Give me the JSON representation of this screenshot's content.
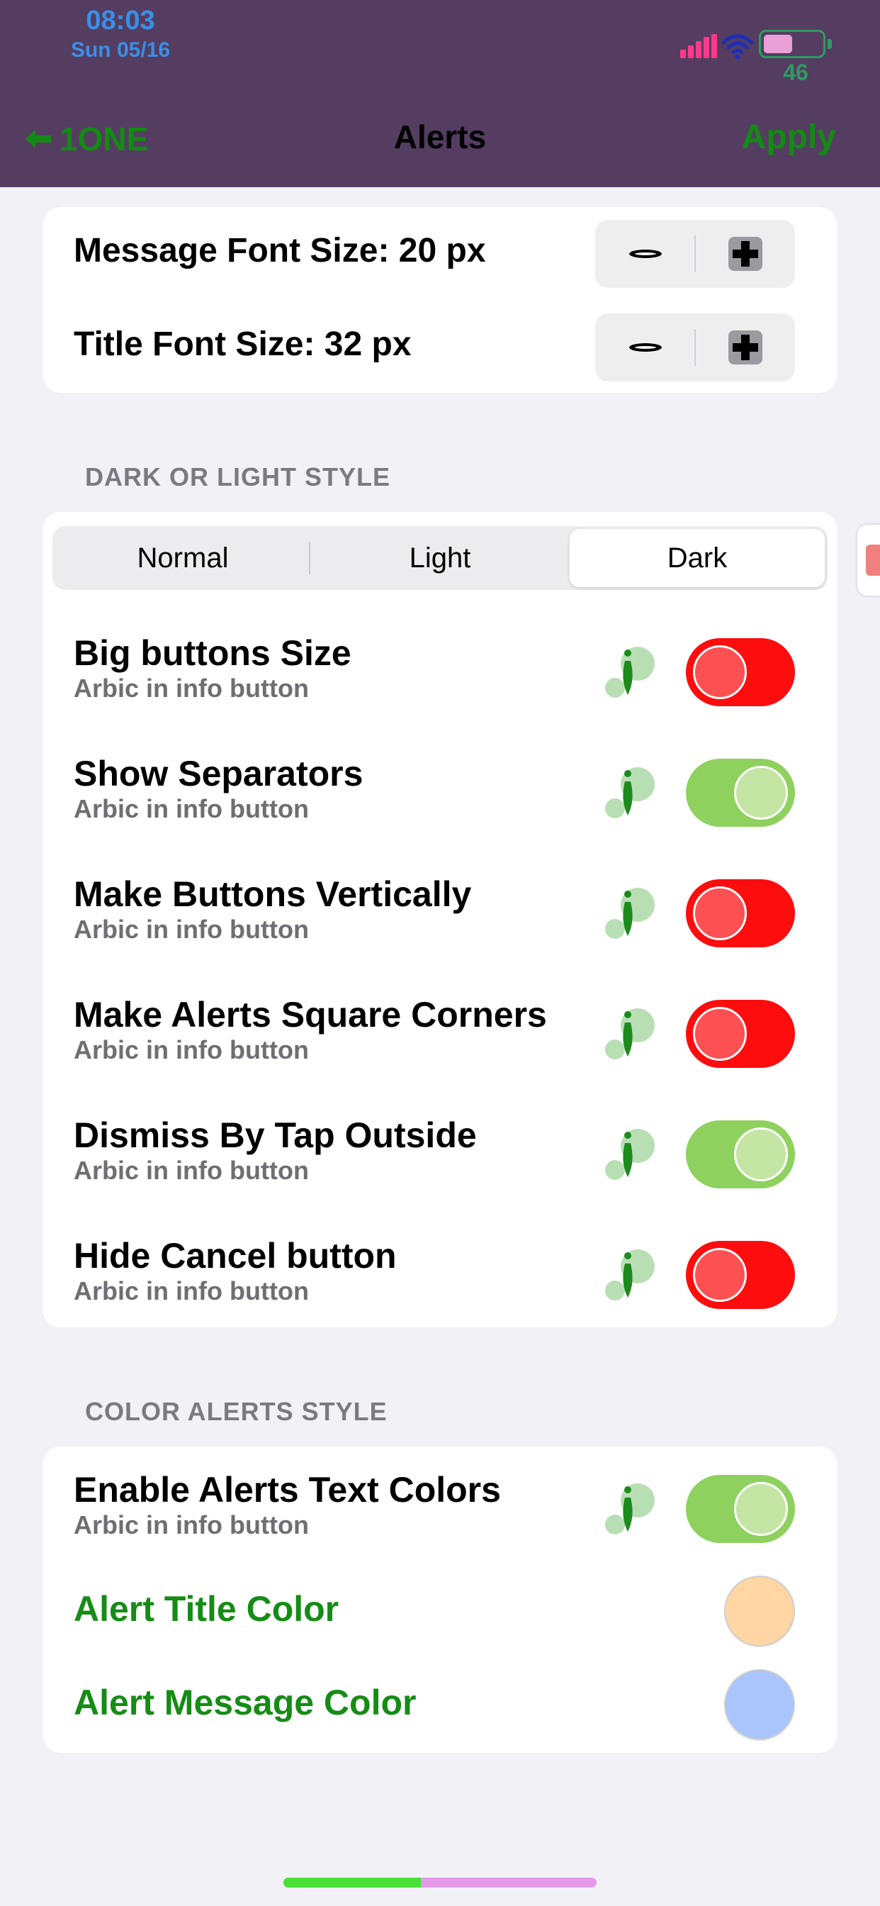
{
  "status_bar": {
    "time": "08:03",
    "date": "Sun 05/16",
    "battery_percent": "46",
    "battery_level": 0.46
  },
  "nav": {
    "back_label": "1ONE",
    "title": "Alerts",
    "apply_label": "Apply"
  },
  "font_settings": {
    "message_font_size": "Message Font Size: 20 px",
    "title_font_size": "Title Font Size: 32 px"
  },
  "style_section": {
    "header": "DARK OR LIGHT STYLE",
    "segments": [
      "Normal",
      "Light",
      "Dark"
    ],
    "selected_segment": "Dark",
    "toggles": [
      {
        "title": "Big buttons Size",
        "subtitle": "Arbic in info button",
        "on": false
      },
      {
        "title": "Show Separators",
        "subtitle": "Arbic in info button",
        "on": true
      },
      {
        "title": "Make Buttons Vertically",
        "subtitle": "Arbic in info button",
        "on": false
      },
      {
        "title": "Make Alerts Square Corners",
        "subtitle": "Arbic in info button",
        "on": false
      },
      {
        "title": "Dismiss By Tap Outside",
        "subtitle": "Arbic in info button",
        "on": true
      },
      {
        "title": "Hide Cancel button",
        "subtitle": "Arbic in info button",
        "on": false
      }
    ]
  },
  "color_section": {
    "header": "COLOR ALERTS STYLE",
    "enable_toggle": {
      "title": "Enable Alerts Text Colors",
      "subtitle": "Arbic in info button",
      "on": true
    },
    "alert_title_color": {
      "label": "Alert Title Color",
      "color": "#ffd6a4"
    },
    "alert_message_color": {
      "label": "Alert Message Color",
      "color": "#a9c5fb"
    }
  },
  "colors": {
    "nav_background": "#543d61",
    "accent_green": "#138a13",
    "toggle_off": "#fd0d0e",
    "toggle_on": "#8fd15f",
    "status_blue": "#3a8fe6"
  },
  "icons": {
    "back": "arrow-left-icon",
    "minus": "minus-icon",
    "plus": "plus-icon",
    "info": "info-icon",
    "wifi": "wifi-icon",
    "signal": "signal-icon",
    "battery": "battery-icon"
  },
  "home_indicator_progress": 0.44
}
